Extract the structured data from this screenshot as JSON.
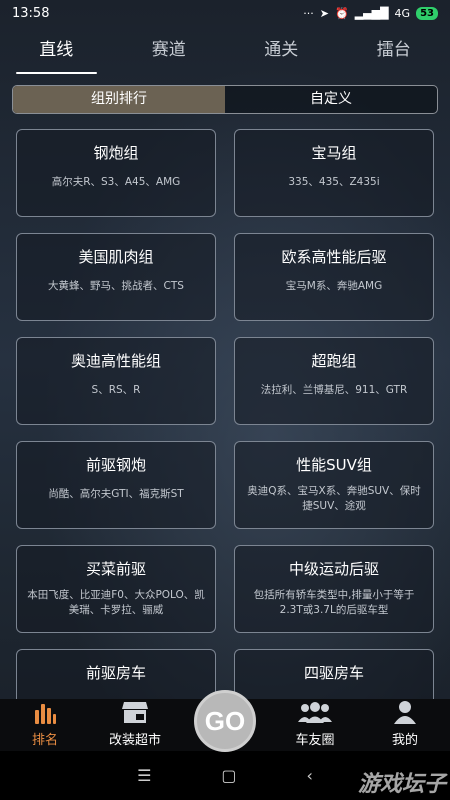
{
  "status_bar": {
    "time": "13:58",
    "dots": "···",
    "network": "4G",
    "battery": "53"
  },
  "top_tabs": [
    {
      "label": "直线",
      "active": true
    },
    {
      "label": "赛道",
      "active": false
    },
    {
      "label": "通关",
      "active": false
    },
    {
      "label": "擂台",
      "active": false
    }
  ],
  "segment": {
    "left": "组别排行",
    "right": "自定义"
  },
  "cards": [
    {
      "title": "钢炮组",
      "desc": "高尔夫R、S3、A45、AMG"
    },
    {
      "title": "宝马组",
      "desc": "335、435、Z435i"
    },
    {
      "title": "美国肌肉组",
      "desc": "大黄蜂、野马、挑战者、CTS"
    },
    {
      "title": "欧系高性能后驱",
      "desc": "宝马M系、奔驰AMG"
    },
    {
      "title": "奥迪高性能组",
      "desc": "S、RS、R"
    },
    {
      "title": "超跑组",
      "desc": "法拉利、兰博基尼、911、GTR"
    },
    {
      "title": "前驱钢炮",
      "desc": "尚酷、高尔夫GTI、福克斯ST"
    },
    {
      "title": "性能SUV组",
      "desc": "奥迪Q系、宝马X系、奔驰SUV、保时捷SUV、途观"
    },
    {
      "title": "买菜前驱",
      "desc": "本田飞度、比亚迪F0、大众POLO、凯美瑞、卡罗拉、骊威"
    },
    {
      "title": "中级运动后驱",
      "desc": "包括所有轿车类型中,排量小于等于2.3T或3.7L的后驱车型"
    },
    {
      "title": "前驱房车",
      "desc": ""
    },
    {
      "title": "四驱房车",
      "desc": ""
    }
  ],
  "bottom_nav": {
    "rank": "排名",
    "shop": "改装超市",
    "go": "GO",
    "friends": "车友圈",
    "mine": "我的"
  },
  "colors": {
    "accent": "#e98d42",
    "segment_active": "#6b6253"
  },
  "watermark": "游戏坛子"
}
